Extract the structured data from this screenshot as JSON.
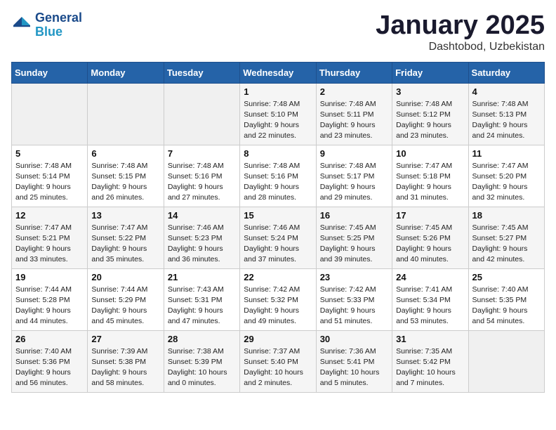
{
  "logo": {
    "line1": "General",
    "line2": "Blue"
  },
  "header": {
    "title": "January 2025",
    "subtitle": "Dashtobod, Uzbekistan"
  },
  "weekdays": [
    "Sunday",
    "Monday",
    "Tuesday",
    "Wednesday",
    "Thursday",
    "Friday",
    "Saturday"
  ],
  "weeks": [
    [
      {
        "day": "",
        "sunrise": "",
        "sunset": "",
        "daylight": ""
      },
      {
        "day": "",
        "sunrise": "",
        "sunset": "",
        "daylight": ""
      },
      {
        "day": "",
        "sunrise": "",
        "sunset": "",
        "daylight": ""
      },
      {
        "day": "1",
        "sunrise": "Sunrise: 7:48 AM",
        "sunset": "Sunset: 5:10 PM",
        "daylight": "Daylight: 9 hours and 22 minutes."
      },
      {
        "day": "2",
        "sunrise": "Sunrise: 7:48 AM",
        "sunset": "Sunset: 5:11 PM",
        "daylight": "Daylight: 9 hours and 23 minutes."
      },
      {
        "day": "3",
        "sunrise": "Sunrise: 7:48 AM",
        "sunset": "Sunset: 5:12 PM",
        "daylight": "Daylight: 9 hours and 23 minutes."
      },
      {
        "day": "4",
        "sunrise": "Sunrise: 7:48 AM",
        "sunset": "Sunset: 5:13 PM",
        "daylight": "Daylight: 9 hours and 24 minutes."
      }
    ],
    [
      {
        "day": "5",
        "sunrise": "Sunrise: 7:48 AM",
        "sunset": "Sunset: 5:14 PM",
        "daylight": "Daylight: 9 hours and 25 minutes."
      },
      {
        "day": "6",
        "sunrise": "Sunrise: 7:48 AM",
        "sunset": "Sunset: 5:15 PM",
        "daylight": "Daylight: 9 hours and 26 minutes."
      },
      {
        "day": "7",
        "sunrise": "Sunrise: 7:48 AM",
        "sunset": "Sunset: 5:16 PM",
        "daylight": "Daylight: 9 hours and 27 minutes."
      },
      {
        "day": "8",
        "sunrise": "Sunrise: 7:48 AM",
        "sunset": "Sunset: 5:16 PM",
        "daylight": "Daylight: 9 hours and 28 minutes."
      },
      {
        "day": "9",
        "sunrise": "Sunrise: 7:48 AM",
        "sunset": "Sunset: 5:17 PM",
        "daylight": "Daylight: 9 hours and 29 minutes."
      },
      {
        "day": "10",
        "sunrise": "Sunrise: 7:47 AM",
        "sunset": "Sunset: 5:18 PM",
        "daylight": "Daylight: 9 hours and 31 minutes."
      },
      {
        "day": "11",
        "sunrise": "Sunrise: 7:47 AM",
        "sunset": "Sunset: 5:20 PM",
        "daylight": "Daylight: 9 hours and 32 minutes."
      }
    ],
    [
      {
        "day": "12",
        "sunrise": "Sunrise: 7:47 AM",
        "sunset": "Sunset: 5:21 PM",
        "daylight": "Daylight: 9 hours and 33 minutes."
      },
      {
        "day": "13",
        "sunrise": "Sunrise: 7:47 AM",
        "sunset": "Sunset: 5:22 PM",
        "daylight": "Daylight: 9 hours and 35 minutes."
      },
      {
        "day": "14",
        "sunrise": "Sunrise: 7:46 AM",
        "sunset": "Sunset: 5:23 PM",
        "daylight": "Daylight: 9 hours and 36 minutes."
      },
      {
        "day": "15",
        "sunrise": "Sunrise: 7:46 AM",
        "sunset": "Sunset: 5:24 PM",
        "daylight": "Daylight: 9 hours and 37 minutes."
      },
      {
        "day": "16",
        "sunrise": "Sunrise: 7:45 AM",
        "sunset": "Sunset: 5:25 PM",
        "daylight": "Daylight: 9 hours and 39 minutes."
      },
      {
        "day": "17",
        "sunrise": "Sunrise: 7:45 AM",
        "sunset": "Sunset: 5:26 PM",
        "daylight": "Daylight: 9 hours and 40 minutes."
      },
      {
        "day": "18",
        "sunrise": "Sunrise: 7:45 AM",
        "sunset": "Sunset: 5:27 PM",
        "daylight": "Daylight: 9 hours and 42 minutes."
      }
    ],
    [
      {
        "day": "19",
        "sunrise": "Sunrise: 7:44 AM",
        "sunset": "Sunset: 5:28 PM",
        "daylight": "Daylight: 9 hours and 44 minutes."
      },
      {
        "day": "20",
        "sunrise": "Sunrise: 7:44 AM",
        "sunset": "Sunset: 5:29 PM",
        "daylight": "Daylight: 9 hours and 45 minutes."
      },
      {
        "day": "21",
        "sunrise": "Sunrise: 7:43 AM",
        "sunset": "Sunset: 5:31 PM",
        "daylight": "Daylight: 9 hours and 47 minutes."
      },
      {
        "day": "22",
        "sunrise": "Sunrise: 7:42 AM",
        "sunset": "Sunset: 5:32 PM",
        "daylight": "Daylight: 9 hours and 49 minutes."
      },
      {
        "day": "23",
        "sunrise": "Sunrise: 7:42 AM",
        "sunset": "Sunset: 5:33 PM",
        "daylight": "Daylight: 9 hours and 51 minutes."
      },
      {
        "day": "24",
        "sunrise": "Sunrise: 7:41 AM",
        "sunset": "Sunset: 5:34 PM",
        "daylight": "Daylight: 9 hours and 53 minutes."
      },
      {
        "day": "25",
        "sunrise": "Sunrise: 7:40 AM",
        "sunset": "Sunset: 5:35 PM",
        "daylight": "Daylight: 9 hours and 54 minutes."
      }
    ],
    [
      {
        "day": "26",
        "sunrise": "Sunrise: 7:40 AM",
        "sunset": "Sunset: 5:36 PM",
        "daylight": "Daylight: 9 hours and 56 minutes."
      },
      {
        "day": "27",
        "sunrise": "Sunrise: 7:39 AM",
        "sunset": "Sunset: 5:38 PM",
        "daylight": "Daylight: 9 hours and 58 minutes."
      },
      {
        "day": "28",
        "sunrise": "Sunrise: 7:38 AM",
        "sunset": "Sunset: 5:39 PM",
        "daylight": "Daylight: 10 hours and 0 minutes."
      },
      {
        "day": "29",
        "sunrise": "Sunrise: 7:37 AM",
        "sunset": "Sunset: 5:40 PM",
        "daylight": "Daylight: 10 hours and 2 minutes."
      },
      {
        "day": "30",
        "sunrise": "Sunrise: 7:36 AM",
        "sunset": "Sunset: 5:41 PM",
        "daylight": "Daylight: 10 hours and 5 minutes."
      },
      {
        "day": "31",
        "sunrise": "Sunrise: 7:35 AM",
        "sunset": "Sunset: 5:42 PM",
        "daylight": "Daylight: 10 hours and 7 minutes."
      },
      {
        "day": "",
        "sunrise": "",
        "sunset": "",
        "daylight": ""
      }
    ]
  ]
}
